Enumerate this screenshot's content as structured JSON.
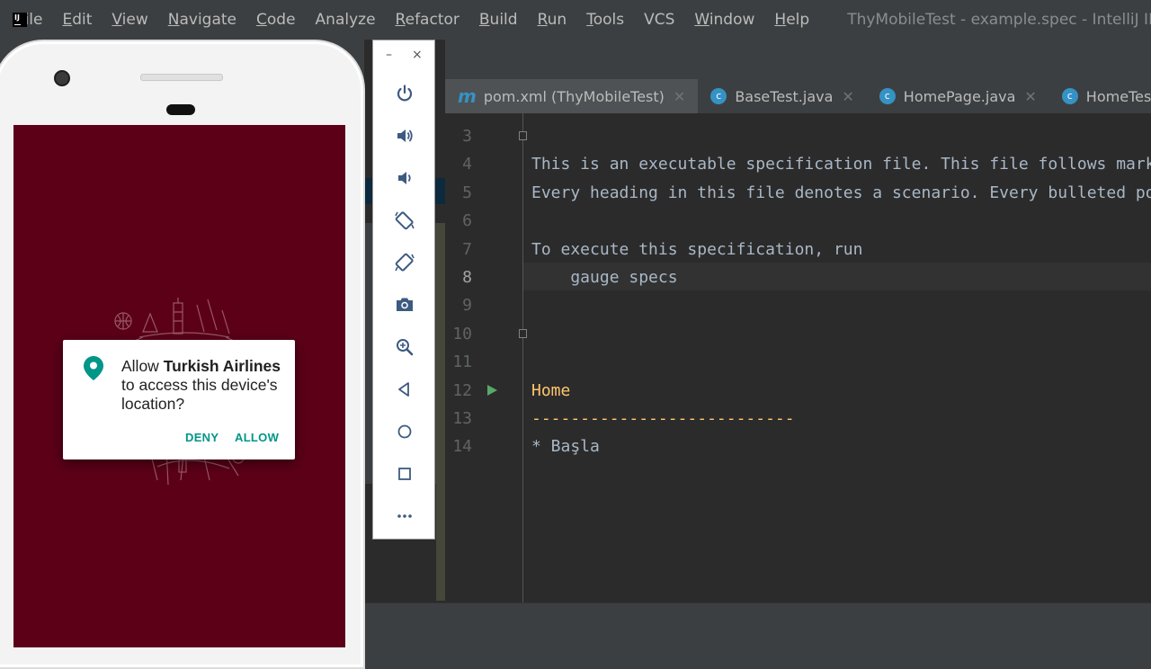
{
  "menubar": {
    "items": [
      {
        "label": "File",
        "mn": "F",
        "rest": "ile"
      },
      {
        "label": "Edit",
        "mn": "E",
        "rest": "dit"
      },
      {
        "label": "View",
        "mn": "V",
        "rest": "iew"
      },
      {
        "label": "Navigate",
        "mn": "N",
        "rest": "avigate"
      },
      {
        "label": "Code",
        "mn": "C",
        "rest": "ode"
      },
      {
        "label": "Analyze",
        "mn": "",
        "rest": "Analyze"
      },
      {
        "label": "Refactor",
        "mn": "R",
        "rest": "efactor"
      },
      {
        "label": "Build",
        "mn": "B",
        "rest": "uild"
      },
      {
        "label": "Run",
        "mn": "R",
        "rest": "un"
      },
      {
        "label": "Tools",
        "mn": "T",
        "rest": "ools"
      },
      {
        "label": "VCS",
        "mn": "",
        "rest": "VCS"
      },
      {
        "label": "Window",
        "mn": "W",
        "rest": "indow"
      },
      {
        "label": "Help",
        "mn": "H",
        "rest": "elp"
      }
    ],
    "window_title": "ThyMobileTest - example.spec - IntelliJ IDEA"
  },
  "tabs": [
    {
      "label": "pom.xml (ThyMobileTest)",
      "icon": "maven-icon",
      "close": "✕"
    },
    {
      "label": "BaseTest.java",
      "icon": "class-icon",
      "close": "✕"
    },
    {
      "label": "HomePage.java",
      "icon": "class-icon",
      "close": "✕"
    },
    {
      "label": "HomeTest.java",
      "icon": "class-icon",
      "close": "✕"
    }
  ],
  "editor": {
    "current_line": "8",
    "lines": [
      {
        "num": "3",
        "text": ""
      },
      {
        "num": "4",
        "text": "This is an executable specification file. This file follows markdown syntax."
      },
      {
        "num": "5",
        "text": "Every heading in this file denotes a scenario. Every bulleted point denotes a step."
      },
      {
        "num": "6",
        "text": ""
      },
      {
        "num": "7",
        "text": "To execute this specification, run"
      },
      {
        "num": "8",
        "text": "    gauge specs"
      },
      {
        "num": "9",
        "text": ""
      },
      {
        "num": "10",
        "text": ""
      },
      {
        "num": "11",
        "text": ""
      },
      {
        "num": "12",
        "text": "Home"
      },
      {
        "num": "13",
        "text": "---------------------------"
      },
      {
        "num": "14",
        "text": "* Başla"
      }
    ]
  },
  "dialog": {
    "text_pre": "Allow ",
    "app_name": "Turkish Airlines",
    "text_post": " to access this device's location?",
    "deny": "DENY",
    "allow": "ALLOW",
    "accent": "#009688"
  },
  "emulator": {
    "minimize": "–",
    "close": "×",
    "buttons": [
      "power-icon",
      "volume-up-icon",
      "volume-down-icon",
      "rotate-left-icon",
      "rotate-right-icon",
      "camera-icon",
      "zoom-icon",
      "back-icon",
      "home-icon",
      "overview-icon",
      "more-icon"
    ]
  },
  "colors": {
    "splash": "#5c0018",
    "heading": "#ffc66d",
    "editor_bg": "#2b2b2b"
  }
}
